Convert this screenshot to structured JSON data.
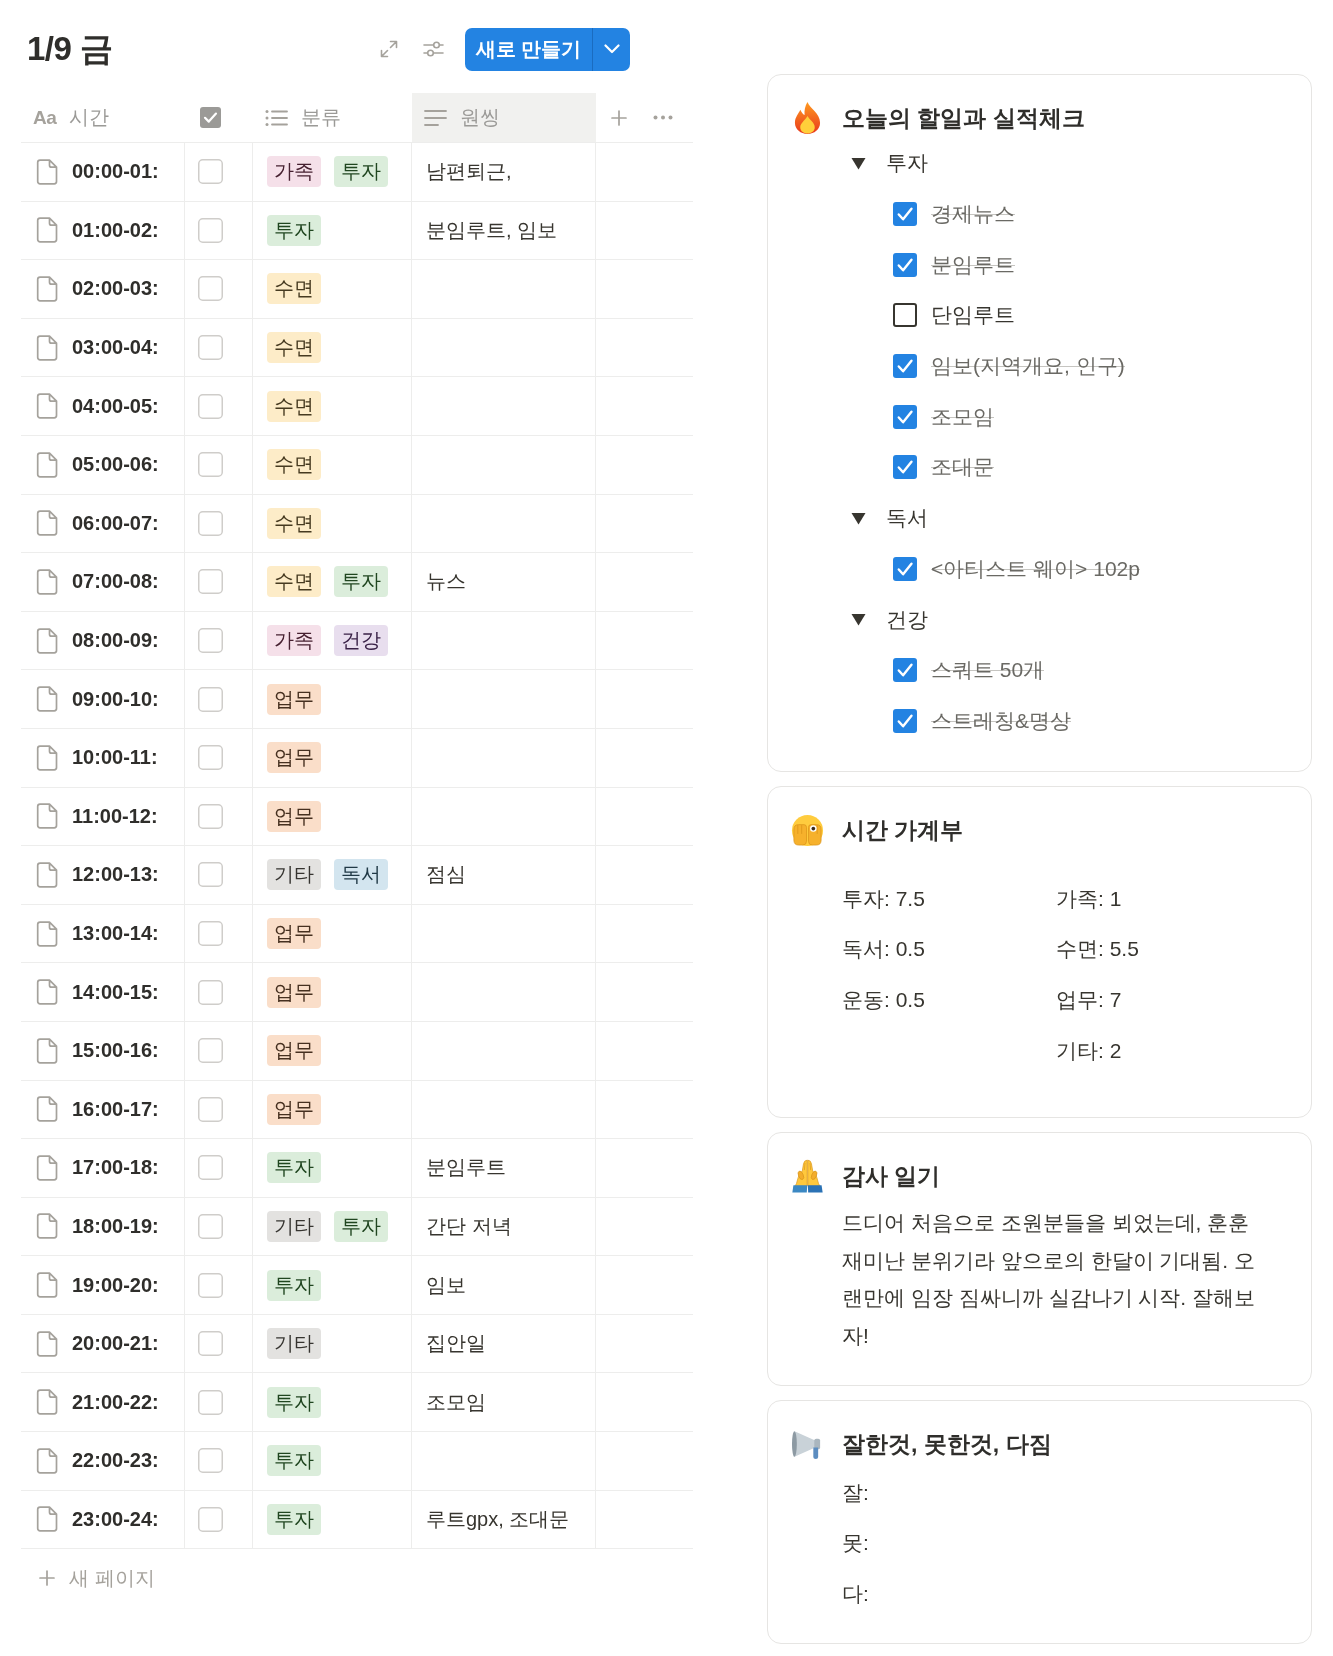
{
  "header": {
    "title": "1/9 금",
    "new_button": "새로 만들기"
  },
  "table": {
    "columns": [
      {
        "kind": "title",
        "icon_label": "Aa",
        "label": "시간",
        "hovered": false
      },
      {
        "kind": "checkbox",
        "hovered": false
      },
      {
        "kind": "multi_select",
        "label": "분류",
        "hovered": false
      },
      {
        "kind": "text",
        "label": "원씽",
        "hovered": true
      }
    ],
    "rows": [
      {
        "time": "00:00-01:",
        "checked": false,
        "tags": [
          {
            "label": "가족",
            "color": "#f5e0e9"
          },
          {
            "label": "투자",
            "color": "#dbeddb"
          }
        ],
        "note": "남편퇴근,"
      },
      {
        "time": "01:00-02:",
        "checked": false,
        "tags": [
          {
            "label": "투자",
            "color": "#dbeddb"
          }
        ],
        "note": "분임루트, 임보"
      },
      {
        "time": "02:00-03:",
        "checked": false,
        "tags": [
          {
            "label": "수면",
            "color": "#fdecc8"
          }
        ]
      },
      {
        "time": "03:00-04:",
        "checked": false,
        "tags": [
          {
            "label": "수면",
            "color": "#fdecc8"
          }
        ]
      },
      {
        "time": "04:00-05:",
        "checked": false,
        "tags": [
          {
            "label": "수면",
            "color": "#fdecc8"
          }
        ]
      },
      {
        "time": "05:00-06:",
        "checked": false,
        "tags": [
          {
            "label": "수면",
            "color": "#fdecc8"
          }
        ]
      },
      {
        "time": "06:00-07:",
        "checked": false,
        "tags": [
          {
            "label": "수면",
            "color": "#fdecc8"
          }
        ]
      },
      {
        "time": "07:00-08:",
        "checked": false,
        "tags": [
          {
            "label": "수면",
            "color": "#fdecc8"
          },
          {
            "label": "투자",
            "color": "#dbeddb"
          }
        ],
        "note": "뉴스"
      },
      {
        "time": "08:00-09:",
        "checked": false,
        "tags": [
          {
            "label": "가족",
            "color": "#f5e0e9"
          },
          {
            "label": "건강",
            "color": "#e8deee"
          }
        ]
      },
      {
        "time": "09:00-10:",
        "checked": false,
        "tags": [
          {
            "label": "업무",
            "color": "#fadec9"
          }
        ]
      },
      {
        "time": "10:00-11:",
        "checked": false,
        "tags": [
          {
            "label": "업무",
            "color": "#fadec9"
          }
        ]
      },
      {
        "time": "11:00-12:",
        "checked": false,
        "tags": [
          {
            "label": "업무",
            "color": "#fadec9"
          }
        ]
      },
      {
        "time": "12:00-13:",
        "checked": false,
        "tags": [
          {
            "label": "기타",
            "color": "#e3e2e0"
          },
          {
            "label": "독서",
            "color": "#d3e5ef"
          }
        ],
        "note": "점심"
      },
      {
        "time": "13:00-14:",
        "checked": false,
        "tags": [
          {
            "label": "업무",
            "color": "#fadec9"
          }
        ]
      },
      {
        "time": "14:00-15:",
        "checked": false,
        "tags": [
          {
            "label": "업무",
            "color": "#fadec9"
          }
        ]
      },
      {
        "time": "15:00-16:",
        "checked": false,
        "tags": [
          {
            "label": "업무",
            "color": "#fadec9"
          }
        ]
      },
      {
        "time": "16:00-17:",
        "checked": false,
        "tags": [
          {
            "label": "업무",
            "color": "#fadec9"
          }
        ]
      },
      {
        "time": "17:00-18:",
        "checked": false,
        "tags": [
          {
            "label": "투자",
            "color": "#dbeddb"
          }
        ],
        "note": "분임루트"
      },
      {
        "time": "18:00-19:",
        "checked": false,
        "tags": [
          {
            "label": "기타",
            "color": "#e3e2e0"
          },
          {
            "label": "투자",
            "color": "#dbeddb"
          }
        ],
        "note": "간단 저녁"
      },
      {
        "time": "19:00-20:",
        "checked": false,
        "tags": [
          {
            "label": "투자",
            "color": "#dbeddb"
          }
        ],
        "note": "임보"
      },
      {
        "time": "20:00-21:",
        "checked": false,
        "tags": [
          {
            "label": "기타",
            "color": "#e3e2e0"
          }
        ],
        "note": "집안일"
      },
      {
        "time": "21:00-22:",
        "checked": false,
        "tags": [
          {
            "label": "투자",
            "color": "#dbeddb"
          }
        ],
        "note": "조모임"
      },
      {
        "time": "22:00-23:",
        "checked": false,
        "tags": [
          {
            "label": "투자",
            "color": "#dbeddb"
          }
        ]
      },
      {
        "time": "23:00-24:",
        "checked": false,
        "tags": [
          {
            "label": "투자",
            "color": "#dbeddb"
          }
        ],
        "note": "루트gpx, 조대문"
      }
    ],
    "new_page": "새 페이지"
  },
  "cards": [
    {
      "kind": "checklist",
      "title": "오늘의 할일과 실적체크",
      "groups": [
        {
          "label": "투자",
          "expanded": true,
          "children": [
            {
              "label": "경제뉴스",
              "checked": true
            },
            {
              "label": "분임루트",
              "checked": true
            },
            {
              "label": "단임루트",
              "checked": false
            },
            {
              "label": "임보(지역개요, 인구)",
              "checked": true
            },
            {
              "label": "조모임",
              "checked": true
            },
            {
              "label": "조대문",
              "checked": true
            }
          ]
        },
        {
          "label": "독서",
          "expanded": true,
          "children": [
            {
              "label": "<아티스트 웨이> 102p",
              "checked": true
            }
          ]
        },
        {
          "label": "건강",
          "expanded": true,
          "children": [
            {
              "label": "스쿼트 50개",
              "checked": true
            },
            {
              "label": "스트레칭&명상",
              "checked": true
            }
          ]
        }
      ]
    },
    {
      "kind": "tally",
      "title": "시간 가계부",
      "columns": [
        [
          "투자: 7.5",
          "독서: 0.5",
          "운동: 0.5"
        ],
        [
          "가족: 1",
          "수면: 5.5",
          "업무: 7",
          "기타: 2"
        ]
      ]
    },
    {
      "kind": "journal",
      "title": "감사 일기",
      "text": "드디어 처음으로 조원분들을 뵈었는데, 훈훈 재미난 분위기라 앞으로의 한달이 기대됨. 오랜만에 임장 짐싸니까 실감나기 시작. 잘해보자!"
    },
    {
      "kind": "prompts",
      "title": "잘한것, 못한것, 다짐",
      "lines": [
        "잘:",
        "못:",
        "다:"
      ]
    }
  ]
}
